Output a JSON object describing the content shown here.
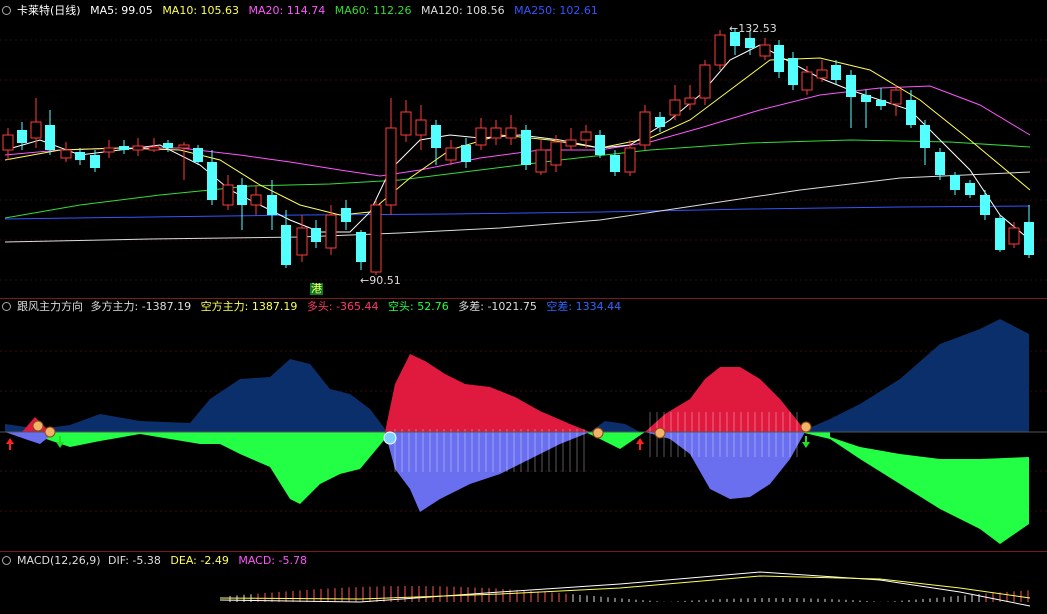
{
  "theme": {
    "bg": "#000000",
    "up": "#ff3b3b",
    "down": "#54ffff",
    "ma5": "#ffffff",
    "ma10": "#ffff55",
    "ma20": "#ff55ff",
    "ma60": "#33dd33",
    "ma120": "#dddddd",
    "ma250": "#3355ff",
    "bull_fill": "#e0193e",
    "bear_fill": "#0b2f6a",
    "pos_fill": "#22ff44",
    "neg_fill": "#6a6ff0"
  },
  "price_panel": {
    "title": "卡莱特(日线)",
    "ma5_label": "MA5: 99.05",
    "ma10_label": "MA10: 105.63",
    "ma20_label": "MA20: 114.74",
    "ma60_label": "MA60: 112.26",
    "ma120_label": "MA120: 108.56",
    "ma250_label": "MA250: 102.61",
    "high_marker": "132.53",
    "low_marker": "90.51",
    "badge": "港"
  },
  "indicator_panel": {
    "name": "跟风主力方向",
    "duofang_label": "多方主力: -1387.19",
    "kongfang_label": "空方主力: 1387.19",
    "duotou_label": "多头: -365.44",
    "kongtou_label": "空头: 52.76",
    "duocha_label": "多差: -1021.75",
    "kongcha_label": "空差: 1334.44"
  },
  "macd_panel": {
    "name": "MACD(12,26,9)",
    "dif_label": "DIF: -5.38",
    "dea_label": "DEA: -2.49",
    "macd_label": "MACD: -5.78"
  }
}
